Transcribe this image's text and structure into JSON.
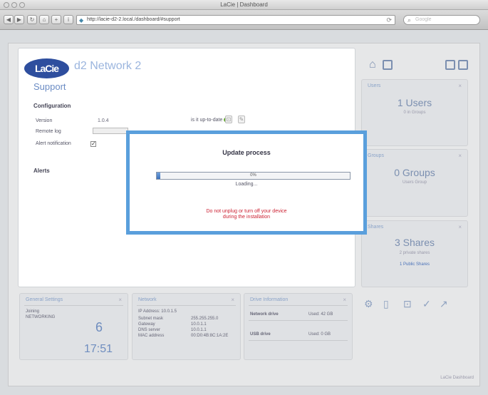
{
  "window": {
    "title": "LaCie | Dashboard"
  },
  "toolbar": {
    "url": "http://lacie-d2-2.local./dashboard/#support",
    "search_placeholder": "Google"
  },
  "header": {
    "logo": "LaCie",
    "product": "d2 Network 2",
    "section": "Support"
  },
  "configuration": {
    "title": "Configuration",
    "rows": [
      {
        "label": "Version",
        "value": "1.0.4"
      },
      {
        "label": "Remote log",
        "value": ""
      },
      {
        "label": "Alert notification",
        "value": ""
      }
    ],
    "status_text": "is it up-to-date",
    "alerts_title": "Alerts"
  },
  "modal": {
    "title": "Update process",
    "progress_percent": 0,
    "progress_label": "0%",
    "status": "Loading...",
    "warning_line1": "Do not unplug or turn off your device",
    "warning_line2": "during the installation"
  },
  "right_widgets": [
    {
      "head": "Users",
      "big": "1 Users",
      "sub": "0 in Groups",
      "link": ""
    },
    {
      "head": "Groups",
      "big": "0 Groups",
      "sub": "Users Group",
      "link": ""
    },
    {
      "head": "Shares",
      "big": "3 Shares",
      "sub": "2 private shares",
      "link": "1 Public Shares"
    }
  ],
  "bottom_widgets": {
    "general": {
      "head": "General Settings",
      "row1": "Joining",
      "row2": "NETWORKING",
      "day": "6",
      "time": "17:51"
    },
    "network": {
      "head": "Network",
      "row1": "IP Address: 10.0.1.5",
      "rows": [
        "Subnet mask",
        "Gateway",
        "DNS server",
        "MAC address"
      ],
      "vals": [
        "255.255.255.0",
        "10.0.1.1",
        "10.0.1.1",
        "00:D0:4B:8C:1A:2E"
      ]
    },
    "drive": {
      "head": "Drive Information",
      "r1": "Network drive",
      "v1": "Used: 42 GB",
      "r2": "USB drive",
      "v2": "Used: 0 GB"
    }
  },
  "footer": "LaCie Dashboard"
}
